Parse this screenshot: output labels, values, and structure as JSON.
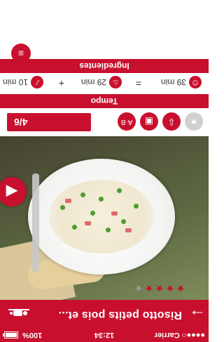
{
  "status": {
    "carrier": "Carrier",
    "time": "12:34",
    "battery_text": "100%",
    "battery_level": 1.0,
    "signal_text": "●●●●○"
  },
  "navbar": {
    "back_glyph": "→",
    "title": "Risotto petits pois et...",
    "chef_icon": "chef-icon"
  },
  "photo": {
    "rating": {
      "filled": 4,
      "total": 5
    },
    "prev_button_glyph": "◀"
  },
  "actions": {
    "portion": "4/6",
    "icons": [
      "heart-icon",
      "download-icon",
      "cart-icon",
      "ab-icon",
      "glasses-icon"
    ]
  },
  "sections": {
    "tempo": "Tempo",
    "ingredienti": "Ingredientes"
  },
  "timebar": {
    "prep": "10 min",
    "cook": "29 min",
    "total": "39 min",
    "plus": "+",
    "equals": "="
  },
  "bottom": {
    "book_icon": "book-icon"
  },
  "colors": {
    "accent": "#c8102e"
  }
}
